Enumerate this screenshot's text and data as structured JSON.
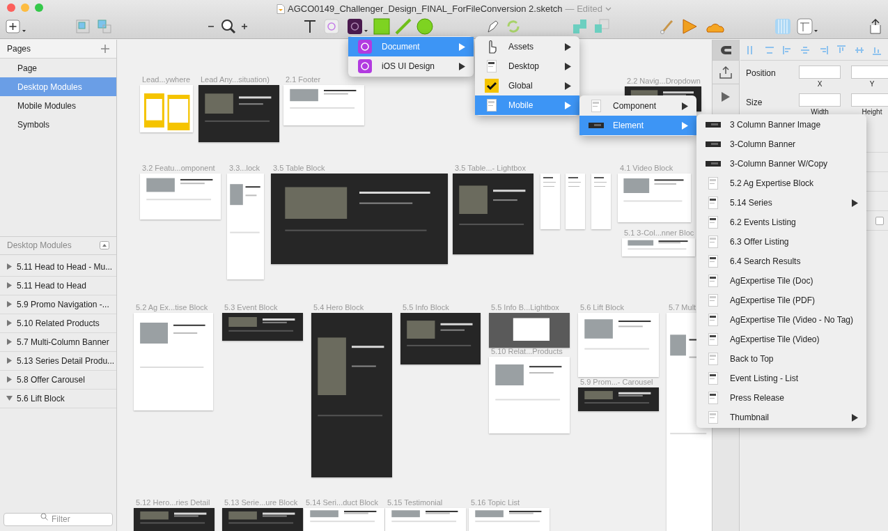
{
  "window": {
    "title": "AGCO0149_Challenger_Design_FINAL_ForFileConversion 2.sketch",
    "status": "— Edited"
  },
  "pages": {
    "title": "Pages",
    "items": [
      {
        "label": "Page",
        "selected": false
      },
      {
        "label": "Desktop Modules",
        "selected": true
      },
      {
        "label": "Mobile Modules",
        "selected": false
      },
      {
        "label": "Symbols",
        "selected": false
      }
    ]
  },
  "layers": {
    "title": "Desktop Modules",
    "items": [
      {
        "label": "5.11 Head to Head - Mu...",
        "expanded": false
      },
      {
        "label": "5.11 Head to Head",
        "expanded": false
      },
      {
        "label": "5.9 Promo Navigation -...",
        "expanded": false
      },
      {
        "label": "5.10 Related Products",
        "expanded": false
      },
      {
        "label": "5.7 Multi-Column Banner",
        "expanded": false
      },
      {
        "label": "5.13 Series Detail Produ...",
        "expanded": false
      },
      {
        "label": "5.8 Offer Carousel",
        "expanded": false
      },
      {
        "label": "5.6 Lift Block",
        "expanded": true
      }
    ],
    "filter_placeholder": "Filter"
  },
  "artboards": [
    {
      "label": "Lead...ywhere",
      "kind": "yellow"
    },
    {
      "label": "Lead Any...situation)",
      "kind": "dark"
    },
    {
      "label": "2.1 Footer",
      "kind": "light"
    },
    {
      "label": "2.2 Navig...Dropdown",
      "kind": "dark"
    },
    {
      "label": "3.2 Featu...omponent",
      "kind": "light"
    },
    {
      "label": "3.3...lock",
      "kind": "light"
    },
    {
      "label": "3.5 Table Block",
      "kind": "dark"
    },
    {
      "label": "3.5 Table...- Lightbox",
      "kind": "dark"
    },
    {
      "label": "4.1 Video Block",
      "kind": "light"
    },
    {
      "label": "5.1 3-Col...nner Bloc",
      "kind": "light"
    },
    {
      "label": "5.2 Ag Ex...tise Block",
      "kind": "light"
    },
    {
      "label": "5.3 Event Block",
      "kind": "dark"
    },
    {
      "label": "5.4 Hero Block",
      "kind": "dark"
    },
    {
      "label": "5.5 Info Block",
      "kind": "dark"
    },
    {
      "label": "5.5 Info B...Lightbox",
      "kind": "gray"
    },
    {
      "label": "5.10 Relat...Products",
      "kind": "light"
    },
    {
      "label": "5.6 Lift Block",
      "kind": "light"
    },
    {
      "label": "5.9 Prom...- Carousel",
      "kind": "dark"
    },
    {
      "label": "5.7 Mult",
      "kind": "light"
    },
    {
      "label": "5.12 Hero...ries Detail",
      "kind": "dark"
    },
    {
      "label": "5.13 Serie...ure Block",
      "kind": "dark"
    },
    {
      "label": "5.14 Seri...duct Block",
      "kind": "light"
    },
    {
      "label": "5.15 Testimonial",
      "kind": "light"
    },
    {
      "label": "5.16 Topic List",
      "kind": "light"
    }
  ],
  "menus": [
    {
      "items": [
        {
          "label": "Document",
          "selected": true,
          "submenu": true
        },
        {
          "label": "iOS UI Design",
          "selected": false,
          "submenu": true
        }
      ]
    },
    {
      "items": [
        {
          "label": "Assets",
          "selected": false,
          "submenu": true
        },
        {
          "label": "Desktop",
          "selected": false,
          "submenu": true
        },
        {
          "label": "Global",
          "selected": false,
          "submenu": true
        },
        {
          "label": "Mobile",
          "selected": true,
          "submenu": true
        }
      ]
    },
    {
      "items": [
        {
          "label": "Component",
          "selected": false,
          "submenu": true
        },
        {
          "label": "Element",
          "selected": true,
          "submenu": true
        }
      ]
    },
    {
      "items": [
        {
          "label": "3 Column Banner Image",
          "selected": false,
          "submenu": false
        },
        {
          "label": "3-Column Banner",
          "selected": false,
          "submenu": false
        },
        {
          "label": "3-Column Banner W/Copy",
          "selected": false,
          "submenu": false
        },
        {
          "label": "5.2 Ag Expertise Block",
          "selected": false,
          "submenu": false
        },
        {
          "label": "5.14 Series",
          "selected": false,
          "submenu": true
        },
        {
          "label": "6.2 Events Listing",
          "selected": false,
          "submenu": false
        },
        {
          "label": "6.3 Offer Listing",
          "selected": false,
          "submenu": false
        },
        {
          "label": "6.4 Search Results",
          "selected": false,
          "submenu": false
        },
        {
          "label": "AgExpertise Tile (Doc)",
          "selected": false,
          "submenu": false
        },
        {
          "label": "AgExpertise Tile (PDF)",
          "selected": false,
          "submenu": false
        },
        {
          "label": "AgExpertise Tile (Video - No Tag)",
          "selected": false,
          "submenu": false
        },
        {
          "label": "AgExpertise Tile (Video)",
          "selected": false,
          "submenu": false
        },
        {
          "label": "Back to Top",
          "selected": false,
          "submenu": false
        },
        {
          "label": "Event Listing - List",
          "selected": false,
          "submenu": false
        },
        {
          "label": "Press Release",
          "selected": false,
          "submenu": false
        },
        {
          "label": "Thumbnail",
          "selected": false,
          "submenu": true
        }
      ]
    }
  ],
  "inspector": {
    "position": "Position",
    "x": "X",
    "y": "Y",
    "size": "Size",
    "width": "Width",
    "height": "Height",
    "checkbox_checked": false
  }
}
